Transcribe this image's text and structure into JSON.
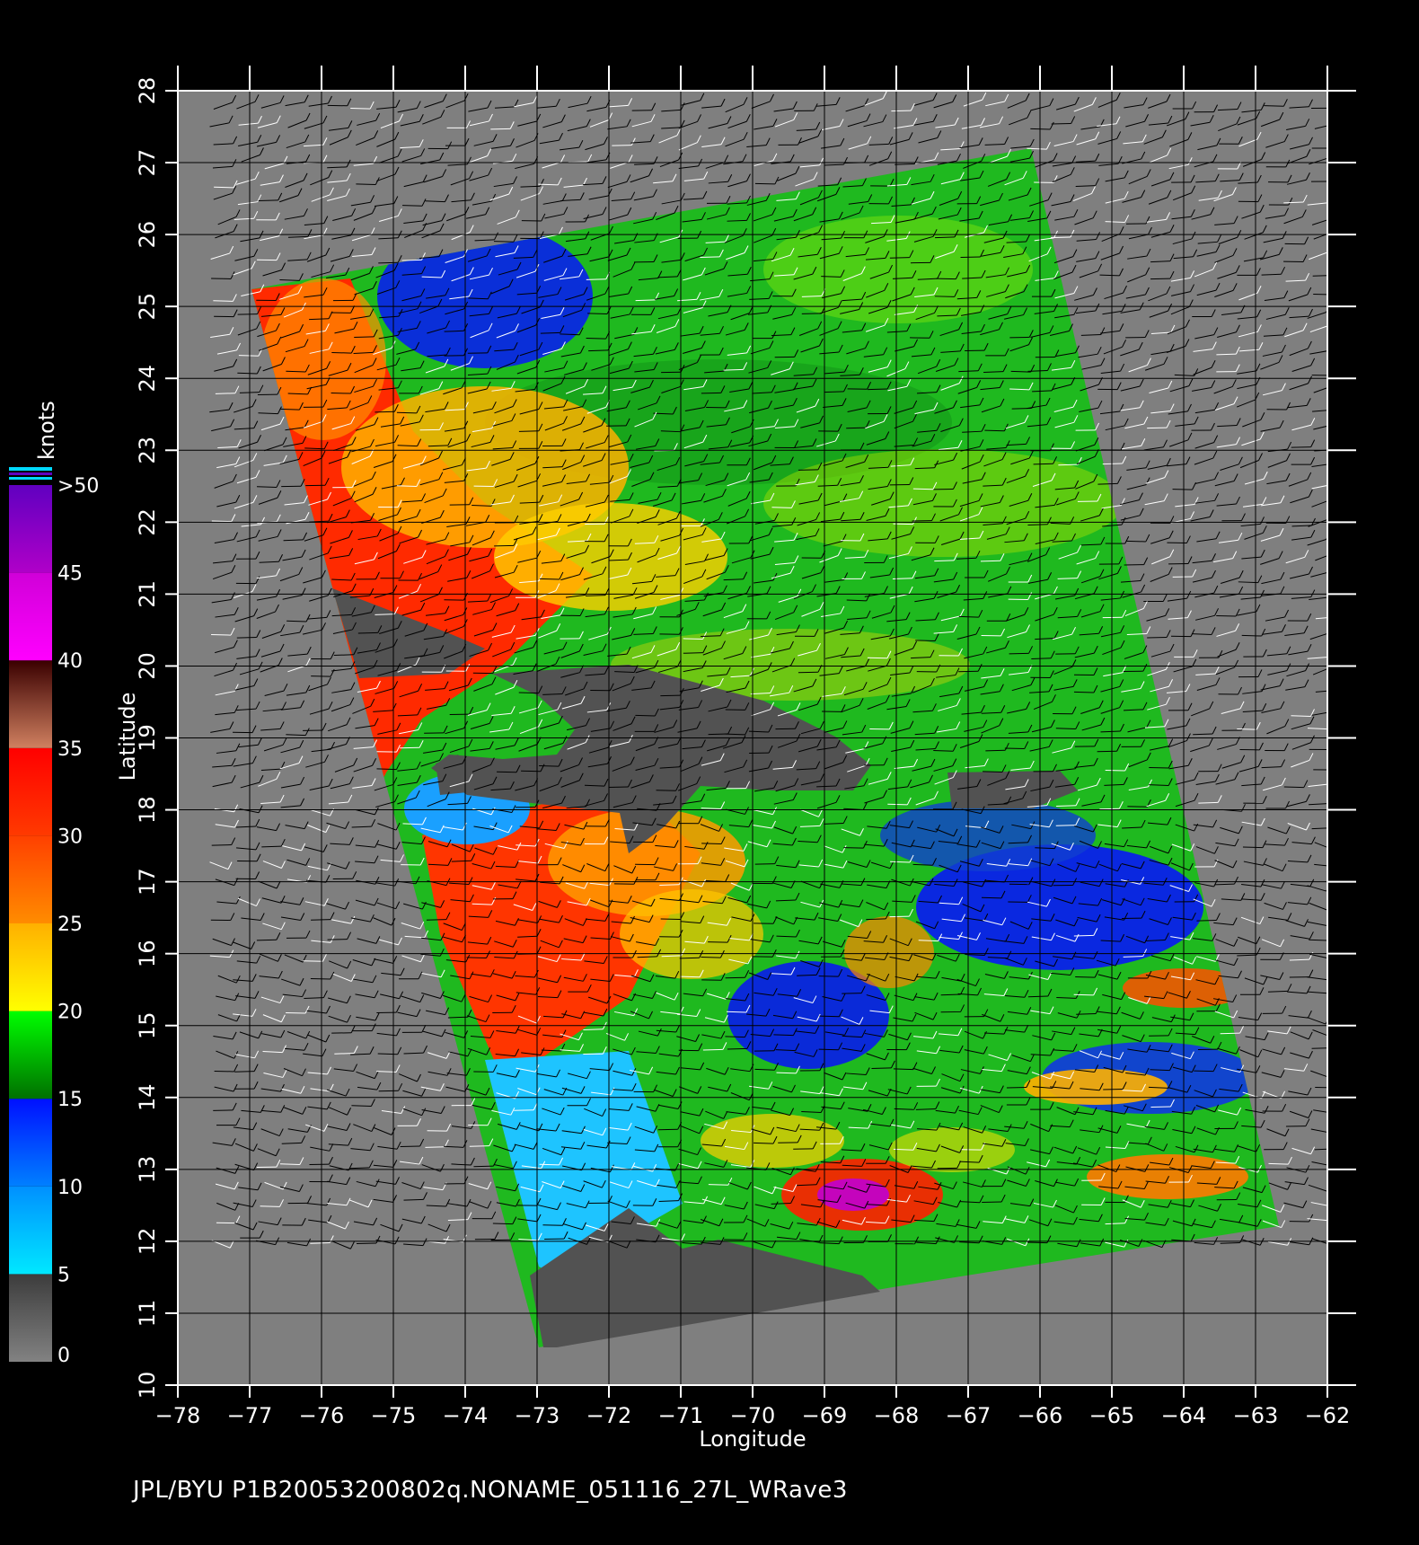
{
  "caption": "JPL/BYU  P1B20053200802q.NONAME_051116_27L_WRave3",
  "map": {
    "xlabel": "Longitude",
    "ylabel": "Latitude",
    "lon_range": [
      -78,
      -62
    ],
    "lat_range": [
      10,
      28
    ],
    "lon_ticks": [
      -78,
      -77,
      -76,
      -75,
      -74,
      -73,
      -72,
      -71,
      -70,
      -69,
      -68,
      -67,
      -66,
      -65,
      -64,
      -63,
      -62
    ],
    "lat_ticks": [
      10,
      11,
      12,
      13,
      14,
      15,
      16,
      17,
      18,
      19,
      20,
      21,
      22,
      23,
      24,
      25,
      26,
      27,
      28
    ],
    "grid": true,
    "background_color": "#7f7f7f",
    "land_color": "#525252"
  },
  "colorbar": {
    "title": "knots",
    "labels": [
      "0",
      "5",
      "10",
      "15",
      "20",
      "25",
      "30",
      "35",
      "40",
      "45",
      ">50"
    ],
    "bands": [
      {
        "from": 0,
        "to": 5,
        "colors": [
          "#828282",
          "#3c3c3c"
        ]
      },
      {
        "from": 5,
        "to": 10,
        "colors": [
          "#00e8ff",
          "#0090ff"
        ]
      },
      {
        "from": 10,
        "to": 15,
        "colors": [
          "#0080ff",
          "#0010ff"
        ]
      },
      {
        "from": 15,
        "to": 20,
        "colors": [
          "#007000",
          "#00ff00"
        ]
      },
      {
        "from": 20,
        "to": 25,
        "colors": [
          "#ffff00",
          "#ffb000"
        ]
      },
      {
        "from": 25,
        "to": 30,
        "colors": [
          "#ff8c00",
          "#ff4000"
        ]
      },
      {
        "from": 30,
        "to": 35,
        "colors": [
          "#ff3a00",
          "#ff0000"
        ]
      },
      {
        "from": 35,
        "to": 40,
        "colors": [
          "#d08060",
          "#3a0000"
        ]
      },
      {
        "from": 40,
        "to": 45,
        "colors": [
          "#ff00ff",
          "#d000d8"
        ]
      },
      {
        "from": 45,
        "to": 50,
        "colors": [
          "#b000c8",
          "#6000c0"
        ]
      }
    ]
  }
}
